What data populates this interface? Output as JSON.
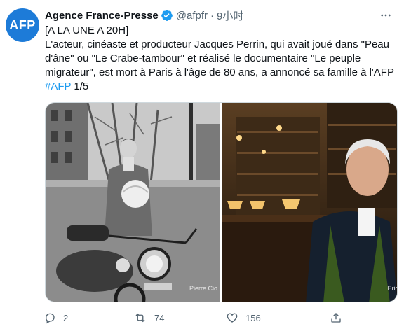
{
  "author": {
    "avatar_text": "AFP",
    "name": "Agence France-Presse",
    "handle": "@afpfr",
    "separator": "·",
    "time": "9小时"
  },
  "tweet": {
    "line1": "[A LA UNE A 20H]",
    "line2": "L'acteur, cinéaste et producteur Jacques Perrin, qui avait joué dans \"Peau d'âne\" ou \"Le Crabe-tambour\" et réalisé le documentaire \"Le peuple migrateur\", est mort à Paris à l'âge de 80 ans, a annoncé sa famille à l'AFP",
    "hashtag": "#AFP",
    "suffix": " 1/5"
  },
  "media": {
    "left_credit": "Pierre Cio",
    "right_credit": "Eric"
  },
  "actions": {
    "reply_count": "2",
    "retweet_count": "74",
    "like_count": "156"
  },
  "colors": {
    "brand": "#1d7bd8",
    "link": "#1d9bf0",
    "muted": "#536471"
  }
}
